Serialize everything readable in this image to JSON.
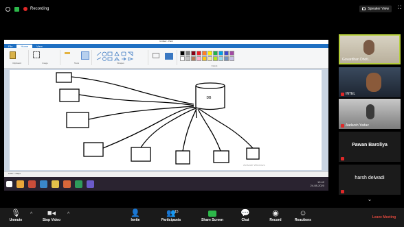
{
  "window": {
    "recording_label": "Recording",
    "speaker_view_label": "Speaker View"
  },
  "shared_screen": {
    "app_title": "Untitled - Paint",
    "ribbon_tabs": [
      "File",
      "Home",
      "View"
    ],
    "ribbon_sections": [
      "Clipboard",
      "Image",
      "Tools",
      "Shapes",
      "Colors"
    ],
    "db_label": "DB",
    "watermark": "Activate Windows",
    "status_text": "1366 × 768px",
    "taskbar_time": "12:42",
    "taskbar_date": "24-08-2020",
    "palette_colors": [
      "#000000",
      "#7f7f7f",
      "#880015",
      "#ed1c24",
      "#ff7f27",
      "#fff200",
      "#22b14c",
      "#00a2e8",
      "#3f48cc",
      "#a349a4",
      "#ffffff",
      "#c3c3c3",
      "#b97a57",
      "#ffaec9",
      "#ffc90e",
      "#efe4b0",
      "#b5e61d",
      "#99d9ea",
      "#7092be",
      "#c8bfe7"
    ]
  },
  "participants": [
    {
      "name": "Govardhan Dhoti...",
      "type": "video",
      "active": true,
      "accent": "#b5ce3a"
    },
    {
      "name": "INTEL",
      "type": "video",
      "active": false
    },
    {
      "name": "Aadarsh Yadav",
      "type": "video",
      "active": false
    },
    {
      "name": "Pawan Baroliya",
      "type": "name",
      "active": false
    },
    {
      "name": "harsh delwadi",
      "type": "name",
      "active": false
    }
  ],
  "more_label": "⌄",
  "toolbar": {
    "unmute": "Unmute",
    "stop_video": "Stop Video",
    "invite": "Invite",
    "participants": "Participants",
    "participants_count": "15",
    "share_screen": "Share Screen",
    "chat": "Chat",
    "record": "Record",
    "reactions": "Reactions",
    "leave": "Leave Meeting"
  },
  "colors": {
    "share_green": "#2db84a",
    "leave_red": "#e0483d",
    "mute_red": "#e02828"
  }
}
